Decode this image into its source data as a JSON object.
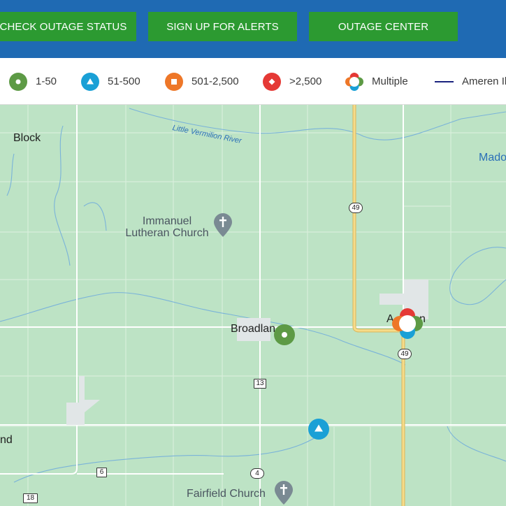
{
  "header": {
    "buttons": [
      {
        "label": "CHECK OUTAGE STATUS"
      },
      {
        "label": "SIGN UP FOR ALERTS"
      },
      {
        "label": "OUTAGE CENTER"
      }
    ]
  },
  "legend": {
    "items": [
      {
        "label": "1-50",
        "icon": "green-circle-icon",
        "color": "#5d9a45"
      },
      {
        "label": "51-500",
        "icon": "blue-triangle-icon",
        "color": "#1aa0d6"
      },
      {
        "label": "501-2,500",
        "icon": "orange-square-icon",
        "color": "#ee7728"
      },
      {
        "label": ">2,500",
        "icon": "red-diamond-icon",
        "color": "#e53935"
      },
      {
        "label": "Multiple",
        "icon": "multiple-icon"
      },
      {
        "label": "Ameren Il",
        "icon": "service-line-icon",
        "color": "#1a237e"
      }
    ]
  },
  "map": {
    "places": {
      "block": "Block",
      "broadlands": "Broadlan",
      "allerton": "A",
      "allerton_tail": "n",
      "madison": "Mado",
      "nd": "nd",
      "river": "Little Vermilion River",
      "immanuel_1": "Immanuel",
      "immanuel_2": "Lutheran Church",
      "fairfield": "Fairfield Church"
    },
    "route_shields": {
      "r49_north": "49",
      "r49_south": "49",
      "r13": "13",
      "r6": "6",
      "r4": "4",
      "r18": "18"
    },
    "outages": [
      {
        "type": "1-50",
        "icon": "green-circle-icon"
      },
      {
        "type": "51-500",
        "icon": "blue-triangle-icon"
      },
      {
        "type": "Multiple",
        "icon": "multiple-icon"
      }
    ]
  }
}
